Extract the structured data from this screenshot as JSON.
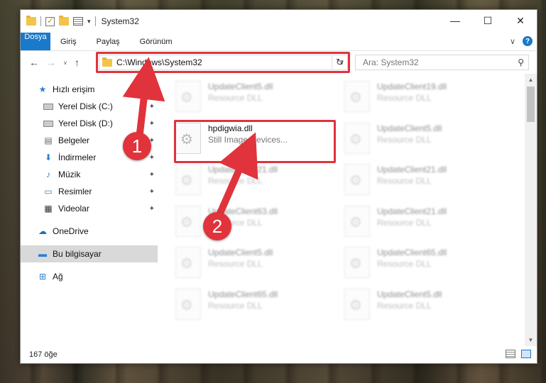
{
  "window": {
    "title": "System32",
    "controls": {
      "minimize": "—",
      "maximize": "☐",
      "close": "✕"
    }
  },
  "ribbon": {
    "tabs": [
      "Dosya",
      "Giriş",
      "Paylaş",
      "Görünüm"
    ],
    "chevron": "∨",
    "help": "?"
  },
  "navbar": {
    "back": "←",
    "forward": "→",
    "recent": "∨",
    "up": "↑",
    "address": "C:\\Windows\\System32",
    "address_dropdown": "∨",
    "refresh": "↻",
    "search_placeholder": "Ara: System32",
    "search_icon": "⚲"
  },
  "sidebar": {
    "quick_access": {
      "label": "Hızlı erişim",
      "icon": "star-icon"
    },
    "pinned": [
      {
        "label": "Yerel Disk (C:)",
        "icon": "drive-icon"
      },
      {
        "label": "Yerel Disk (D:)",
        "icon": "drive-icon"
      },
      {
        "label": "Belgeler",
        "icon": "documents-icon"
      },
      {
        "label": "İndirmeler",
        "icon": "downloads-icon"
      },
      {
        "label": "Müzik",
        "icon": "music-icon"
      },
      {
        "label": "Resimler",
        "icon": "pictures-icon"
      },
      {
        "label": "Videolar",
        "icon": "videos-icon"
      }
    ],
    "onedrive": "OneDrive",
    "this_pc": "Bu bilgisayar",
    "network": "Ağ",
    "pin_glyph": "📌"
  },
  "files": [
    {
      "name": "UpdateClient5.dll",
      "type": "Resource DLL"
    },
    {
      "name": "UpdateClient19.dll",
      "type": "Resource DLL"
    },
    {
      "name": "hpdigwia.dll",
      "type": "Still Image Devices..."
    },
    {
      "name": "UpdateClient5.dll",
      "type": "Resource DLL"
    },
    {
      "name": "UpdateClient21.dll",
      "type": "Resource DLL"
    },
    {
      "name": "UpdateClient21.dll",
      "type": "Resource DLL"
    },
    {
      "name": "UpdateClient63.dll",
      "type": "Resource DLL"
    },
    {
      "name": "UpdateClient21.dll",
      "type": "Resource DLL"
    },
    {
      "name": "UpdateClient5.dll",
      "type": "Resource DLL"
    },
    {
      "name": "UpdateClient65.dll",
      "type": "Resource DLL"
    },
    {
      "name": "UpdateClient65.dll",
      "type": "Resource DLL"
    },
    {
      "name": "UpdateClient5.dll",
      "type": "Resource DLL"
    }
  ],
  "status": {
    "count": "167 öğe"
  },
  "annotations": {
    "step1": "1",
    "step2": "2",
    "color": "#e0333c"
  }
}
